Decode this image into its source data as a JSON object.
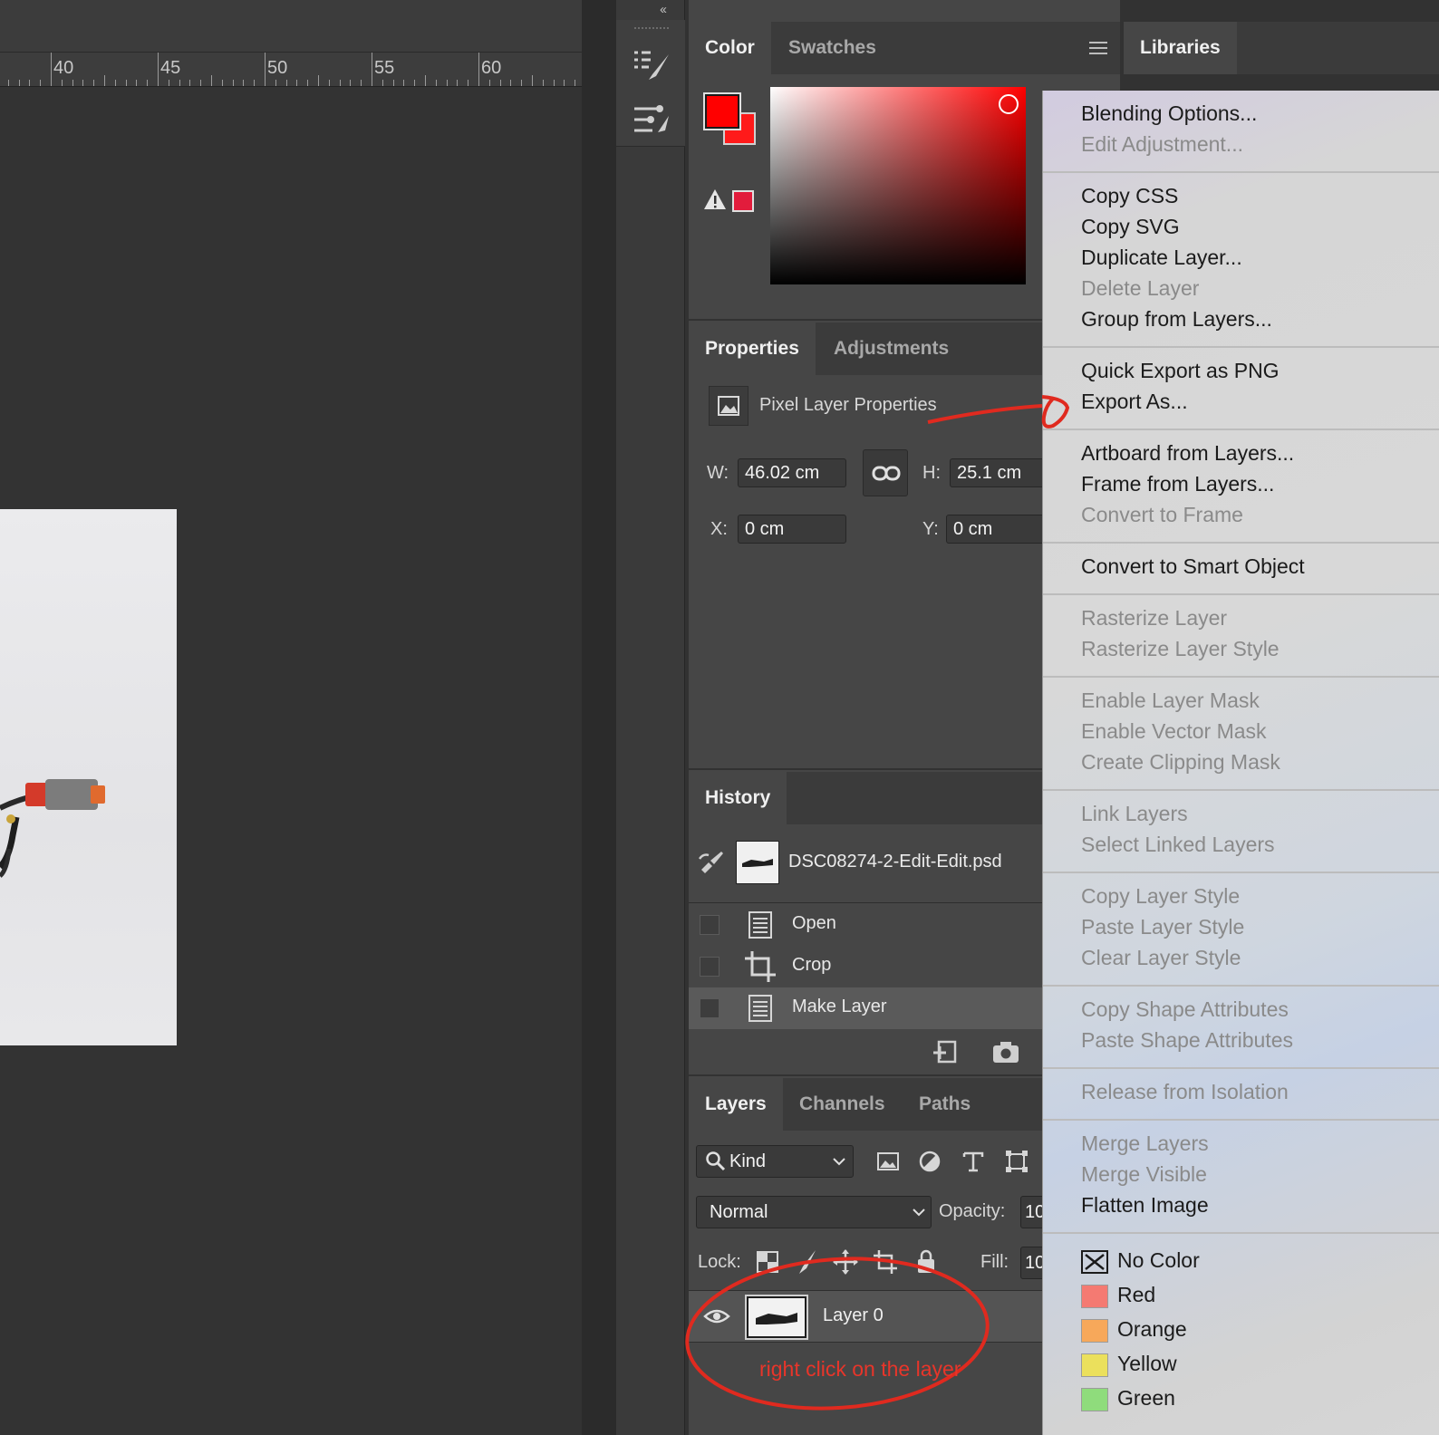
{
  "ruler": {
    "ticks": [
      "40",
      "45",
      "50",
      "55",
      "60"
    ]
  },
  "color_panel": {
    "tabs": [
      "Color",
      "Swatches"
    ],
    "foreground": "#ff0000",
    "background": "#ff1a1a",
    "gamut_swatch": "#e21c3c"
  },
  "libraries_tab": "Libraries",
  "properties_panel": {
    "tabs": [
      "Properties",
      "Adjustments"
    ],
    "section_title": "Pixel Layer Properties",
    "w_label": "W:",
    "w_value": "46.02 cm",
    "h_label": "H:",
    "h_value": "25.1 cm",
    "x_label": "X:",
    "x_value": "0 cm",
    "y_label": "Y:",
    "y_value": "0 cm"
  },
  "history_panel": {
    "tab": "History",
    "document": "DSC08274-2-Edit-Edit.psd",
    "steps": [
      "Open",
      "Crop",
      "Make Layer"
    ]
  },
  "layers_panel": {
    "tabs": [
      "Layers",
      "Channels",
      "Paths"
    ],
    "filter_kind": "Kind",
    "blend_mode": "Normal",
    "opacity_label": "Opacity:",
    "opacity_value": "10",
    "lock_label": "Lock:",
    "fill_label": "Fill:",
    "fill_value": "10",
    "layer_name": "Layer 0"
  },
  "annotation": {
    "text": "right click on the layer",
    "color": "#e8352a"
  },
  "context_menu": {
    "items": [
      {
        "label": "Blending Options...",
        "enabled": true
      },
      {
        "label": "Edit Adjustment...",
        "enabled": false
      },
      {
        "label": "Copy CSS",
        "enabled": true
      },
      {
        "label": "Copy SVG",
        "enabled": true
      },
      {
        "label": "Duplicate Layer...",
        "enabled": true
      },
      {
        "label": "Delete Layer",
        "enabled": false
      },
      {
        "label": "Group from Layers...",
        "enabled": true
      },
      {
        "label": "Quick Export as PNG",
        "enabled": true
      },
      {
        "label": "Export As...",
        "enabled": true
      },
      {
        "label": "Artboard from Layers...",
        "enabled": true
      },
      {
        "label": "Frame from Layers...",
        "enabled": true
      },
      {
        "label": "Convert to Frame",
        "enabled": false
      },
      {
        "label": "Convert to Smart Object",
        "enabled": true
      },
      {
        "label": "Rasterize Layer",
        "enabled": false
      },
      {
        "label": "Rasterize Layer Style",
        "enabled": false
      },
      {
        "label": "Enable Layer Mask",
        "enabled": false
      },
      {
        "label": "Enable Vector Mask",
        "enabled": false
      },
      {
        "label": "Create Clipping Mask",
        "enabled": false
      },
      {
        "label": "Link Layers",
        "enabled": false
      },
      {
        "label": "Select Linked Layers",
        "enabled": false
      },
      {
        "label": "Copy Layer Style",
        "enabled": false
      },
      {
        "label": "Paste Layer Style",
        "enabled": false
      },
      {
        "label": "Clear Layer Style",
        "enabled": false
      },
      {
        "label": "Copy Shape Attributes",
        "enabled": false
      },
      {
        "label": "Paste Shape Attributes",
        "enabled": false
      },
      {
        "label": "Release from Isolation",
        "enabled": false
      },
      {
        "label": "Merge Layers",
        "enabled": false
      },
      {
        "label": "Merge Visible",
        "enabled": false
      },
      {
        "label": "Flatten Image",
        "enabled": true
      }
    ],
    "color_labels": [
      {
        "name": "No Color",
        "color": "none"
      },
      {
        "name": "Red",
        "color": "#f47a72"
      },
      {
        "name": "Orange",
        "color": "#f7a85a"
      },
      {
        "name": "Yellow",
        "color": "#ebe05c"
      },
      {
        "name": "Green",
        "color": "#8fdc7c"
      }
    ]
  }
}
